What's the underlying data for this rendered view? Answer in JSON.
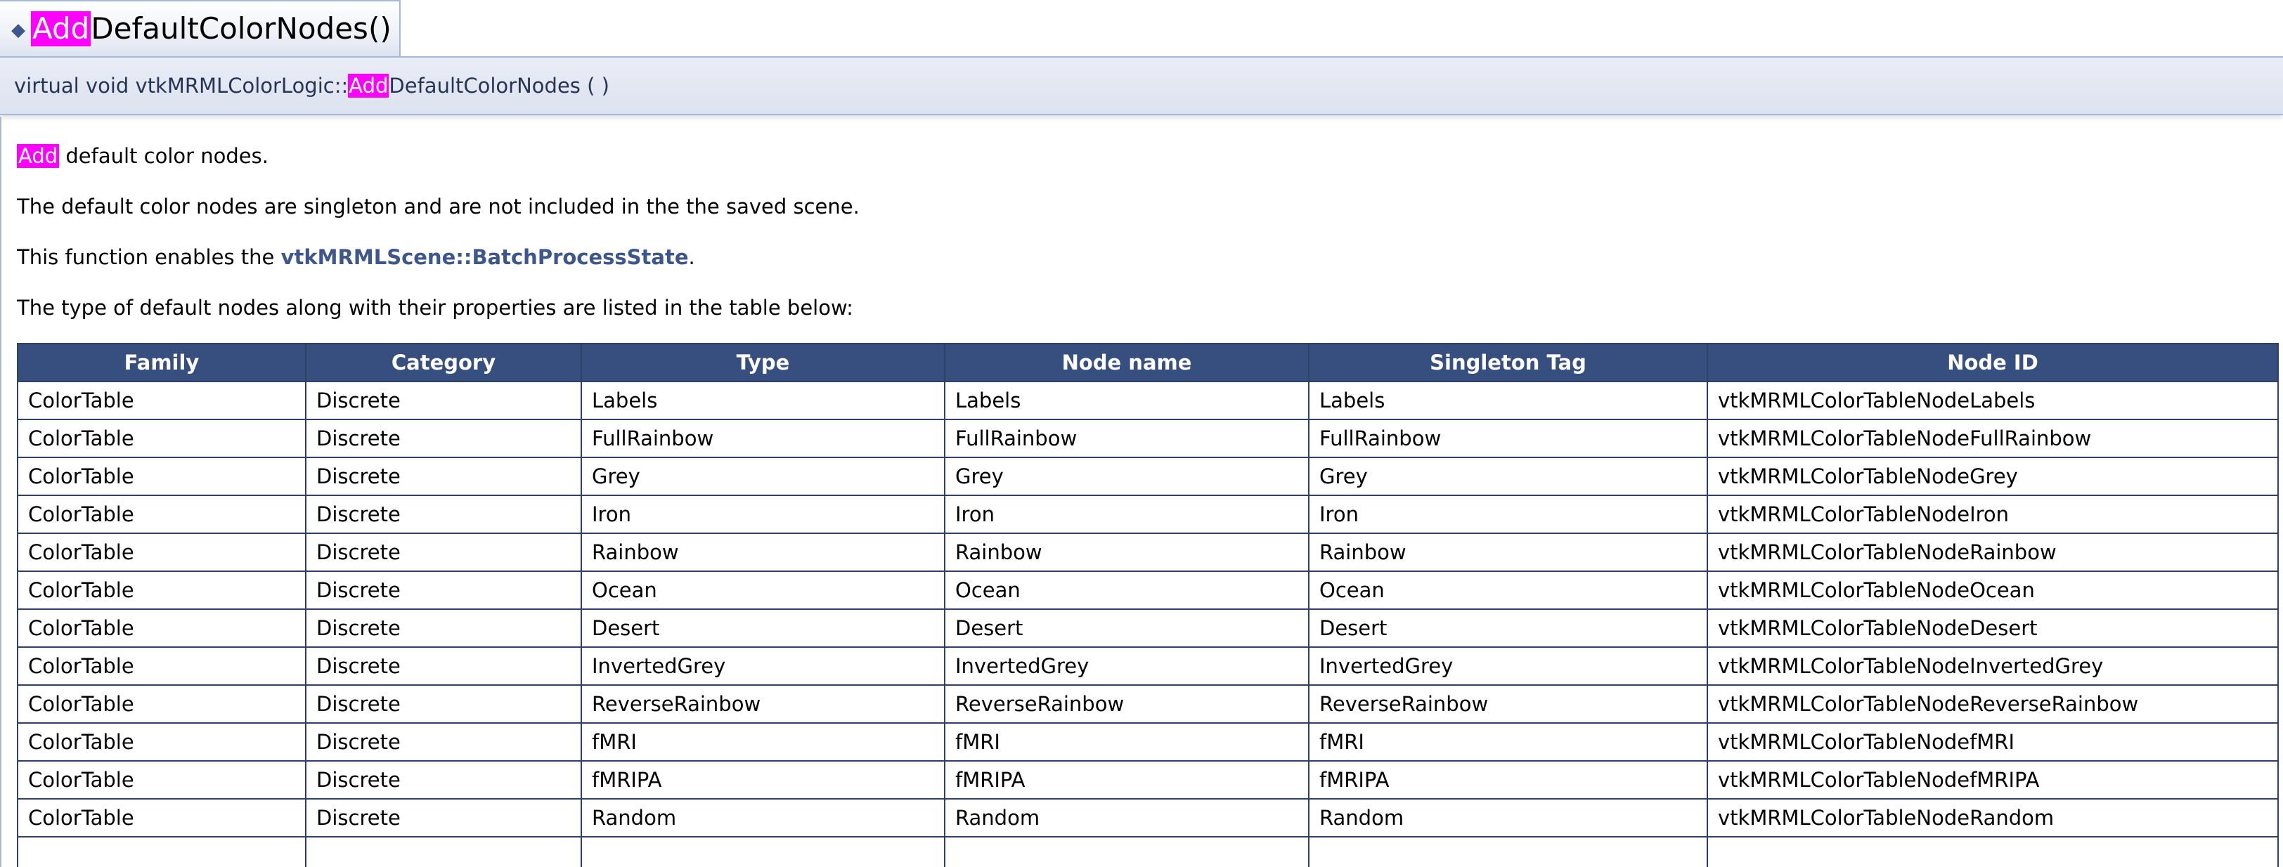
{
  "member": {
    "title_highlight": "Add",
    "title_rest": "DefaultColorNodes()",
    "prototype_prefix": "virtual void vtkMRMLColorLogic::",
    "prototype_highlight": "Add",
    "prototype_suffix": "DefaultColorNodes (  )"
  },
  "doc": {
    "p1_highlight": "Add",
    "p1_rest": " default color nodes.",
    "p2": "The default color nodes are singleton and are not included in the the saved scene.",
    "p3_prefix": "This function enables the ",
    "p3_link": "vtkMRMLScene::BatchProcessState",
    "p3_suffix": ".",
    "p4": "The type of default nodes along with their properties are listed in the table below:"
  },
  "table": {
    "headers": [
      "Family",
      "Category",
      "Type",
      "Node name",
      "Singleton Tag",
      "Node ID"
    ],
    "rows": [
      [
        "ColorTable",
        "Discrete",
        "Labels",
        "Labels",
        "Labels",
        "vtkMRMLColorTableNodeLabels"
      ],
      [
        "ColorTable",
        "Discrete",
        "FullRainbow",
        "FullRainbow",
        "FullRainbow",
        "vtkMRMLColorTableNodeFullRainbow"
      ],
      [
        "ColorTable",
        "Discrete",
        "Grey",
        "Grey",
        "Grey",
        "vtkMRMLColorTableNodeGrey"
      ],
      [
        "ColorTable",
        "Discrete",
        "Iron",
        "Iron",
        "Iron",
        "vtkMRMLColorTableNodeIron"
      ],
      [
        "ColorTable",
        "Discrete",
        "Rainbow",
        "Rainbow",
        "Rainbow",
        "vtkMRMLColorTableNodeRainbow"
      ],
      [
        "ColorTable",
        "Discrete",
        "Ocean",
        "Ocean",
        "Ocean",
        "vtkMRMLColorTableNodeOcean"
      ],
      [
        "ColorTable",
        "Discrete",
        "Desert",
        "Desert",
        "Desert",
        "vtkMRMLColorTableNodeDesert"
      ],
      [
        "ColorTable",
        "Discrete",
        "InvertedGrey",
        "InvertedGrey",
        "InvertedGrey",
        "vtkMRMLColorTableNodeInvertedGrey"
      ],
      [
        "ColorTable",
        "Discrete",
        "ReverseRainbow",
        "ReverseRainbow",
        "ReverseRainbow",
        "vtkMRMLColorTableNodeReverseRainbow"
      ],
      [
        "ColorTable",
        "Discrete",
        "fMRI",
        "fMRI",
        "fMRI",
        "vtkMRMLColorTableNodefMRI"
      ],
      [
        "ColorTable",
        "Discrete",
        "fMRIPA",
        "fMRIPA",
        "fMRIPA",
        "vtkMRMLColorTableNodefMRIPA"
      ],
      [
        "ColorTable",
        "Discrete",
        "Random",
        "Random",
        "Random",
        "vtkMRMLColorTableNodeRandom"
      ],
      [
        "",
        "",
        "",
        "",
        "",
        ""
      ]
    ]
  },
  "colors": {
    "highlight": "#ff00ff",
    "header_bg": "#374f7f",
    "link": "#3d578c"
  }
}
